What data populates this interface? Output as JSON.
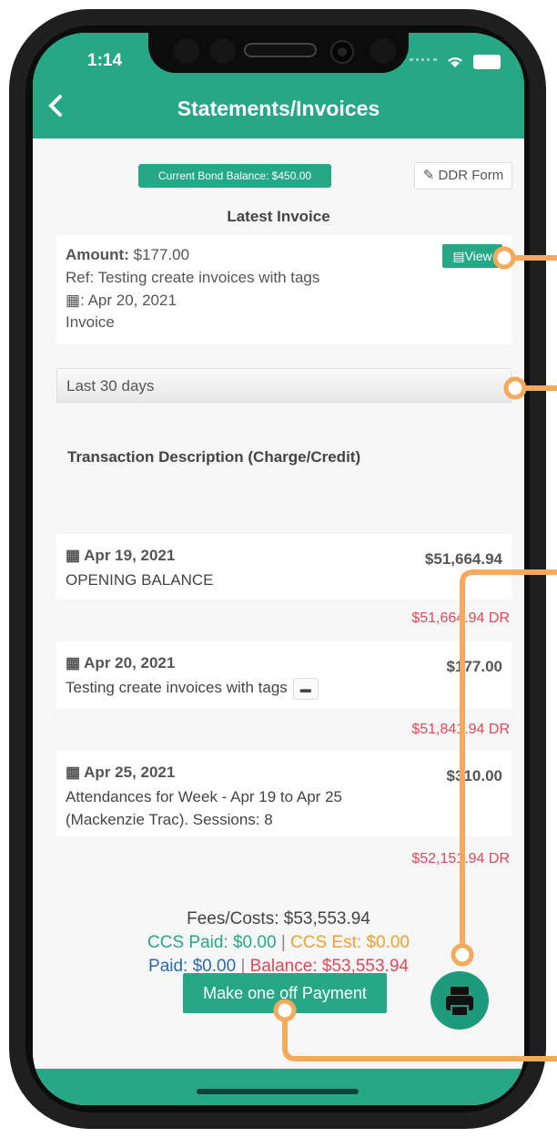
{
  "status": {
    "time": "1:14"
  },
  "header": {
    "title": "Statements/Invoices",
    "back_icon": "chevron-left-icon"
  },
  "bond": {
    "label": "Current Bond Balance: $450.00"
  },
  "ddr": {
    "label": "DDR Form",
    "icon": "edit-icon"
  },
  "latest_invoice": {
    "heading": "Latest Invoice",
    "amount_label": "Amount:",
    "amount_value": "$177.00",
    "ref": "Ref: Testing create invoices with tags",
    "date": ": Apr 20, 2021",
    "type": "Invoice",
    "view_label": "View"
  },
  "filter": {
    "selected": "Last 30 days"
  },
  "transactions": {
    "heading": "Transaction Description (Charge/Credit)",
    "items": [
      {
        "date": "Apr 19, 2021",
        "description": "OPENING BALANCE",
        "amount": "$51,664.94",
        "balance": "$51,664.94 DR"
      },
      {
        "date": "Apr 20, 2021",
        "description": "Testing create invoices with tags",
        "amount": "$177.00",
        "balance": "$51,841.94 DR"
      },
      {
        "date": "Apr 25, 2021",
        "description": "Attendances for Week - Apr 19 to Apr 25 (Mackenzie Trac). Sessions: 8",
        "amount": "$310.00",
        "balance": "$52,151.94 DR"
      }
    ]
  },
  "totals": {
    "fees": "Fees/Costs: $53,553.94",
    "ccs_paid": "CCS Paid: $0.00",
    "ccs_est": "CCS Est: $0.00",
    "paid": "Paid: $0.00",
    "balance": "Balance: $53,553.94",
    "separator": "|"
  },
  "actions": {
    "pay_label": "Make one off Payment",
    "print_icon": "printer-icon"
  },
  "colors": {
    "accent": "#26a887",
    "debit": "#e0485a",
    "ccs_est": "#f0a030",
    "paid": "#2a6bb0",
    "callout": "#f5a95a"
  }
}
